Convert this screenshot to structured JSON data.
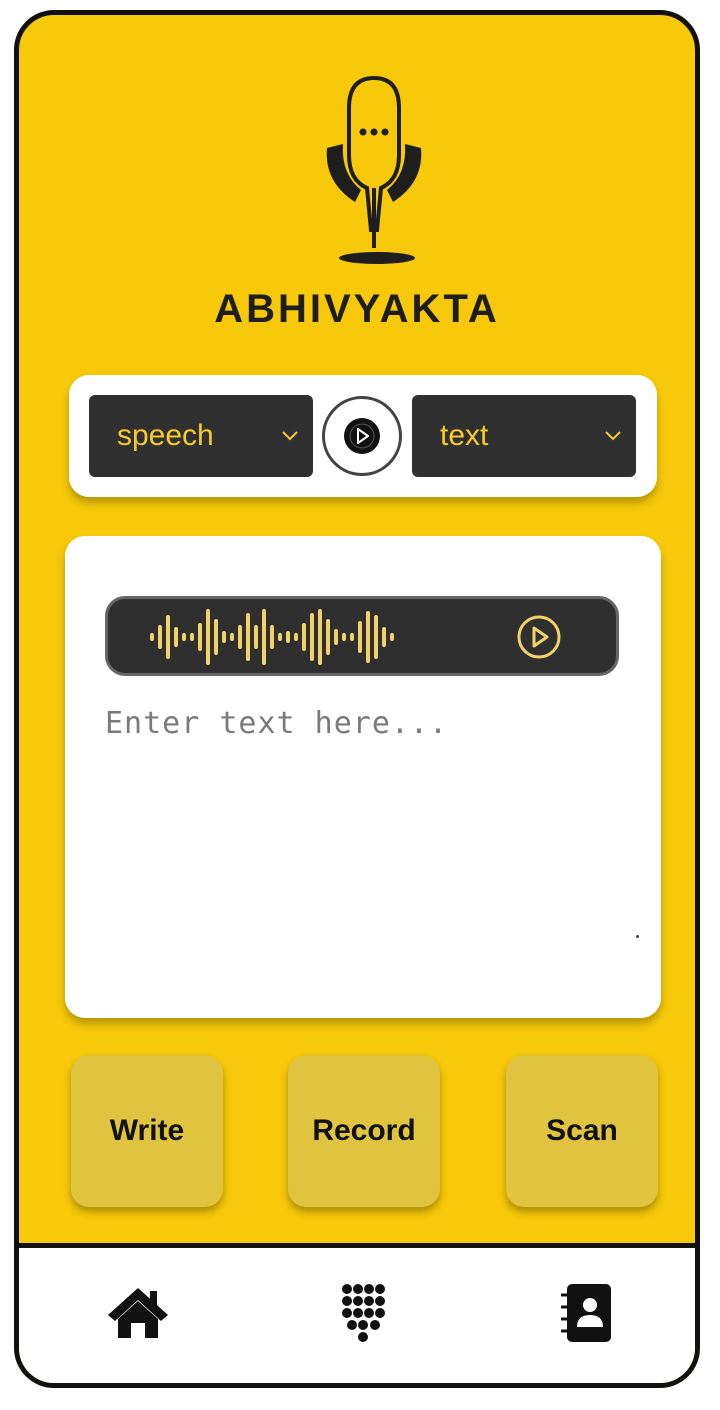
{
  "app": {
    "title": "ABHIVYAKTA",
    "accent": "#f7c90a",
    "dark": "#303030"
  },
  "translator": {
    "source_language": "speech",
    "target_language": "text",
    "swap_icon": "play-circle-icon"
  },
  "input": {
    "placeholder": "Enter text here...",
    "audio_icon": "sound-wave-icon",
    "audio_play_icon": "play-circle-icon"
  },
  "actions": {
    "write_label": "Write",
    "record_label": "Record",
    "scan_label": "Scan"
  },
  "nav": {
    "home_icon": "home-icon",
    "keypad_icon": "dialpad-icon",
    "contacts_icon": "contacts-book-icon"
  }
}
